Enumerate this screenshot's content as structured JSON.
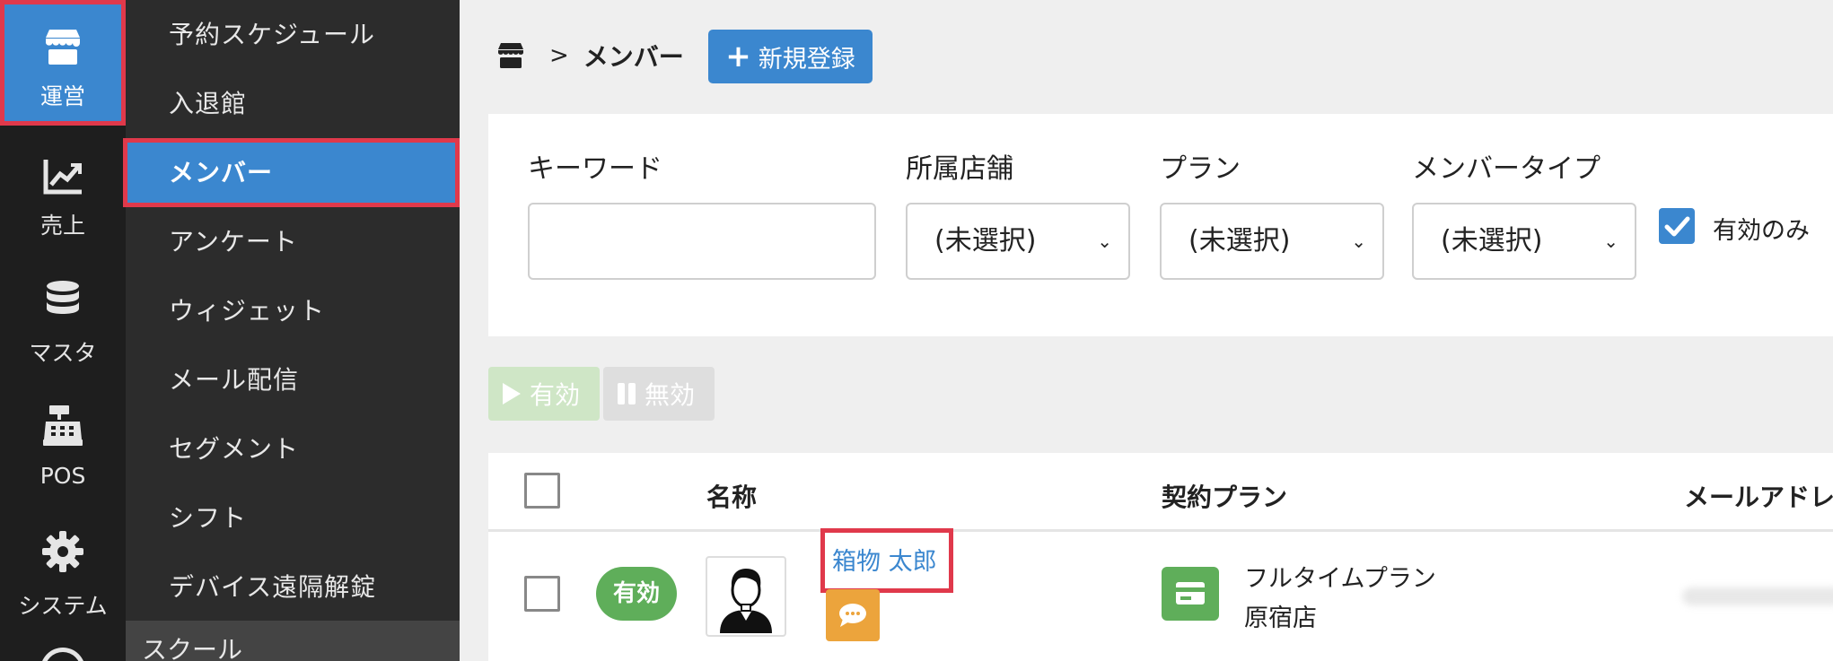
{
  "rail": {
    "items": [
      {
        "label": "運営",
        "icon": "store-icon",
        "active": true
      },
      {
        "label": "売上",
        "icon": "chart-line-icon"
      },
      {
        "label": "マスタ",
        "icon": "database-icon"
      },
      {
        "label": "POS",
        "icon": "cash-register-icon"
      },
      {
        "label": "システム",
        "icon": "gear-icon"
      }
    ]
  },
  "submenu": {
    "items": [
      {
        "label": "予約スケジュール"
      },
      {
        "label": "入退館"
      },
      {
        "label": "メンバー",
        "active": true
      },
      {
        "label": "アンケート"
      },
      {
        "label": "ウィジェット"
      },
      {
        "label": "メール配信"
      },
      {
        "label": "セグメント"
      },
      {
        "label": "シフト"
      },
      {
        "label": "デバイス遠隔解錠"
      }
    ],
    "section": "スクール"
  },
  "breadcrumb": {
    "home_icon": "store-icon",
    "separator": ">",
    "title": "メンバー"
  },
  "new_button": {
    "label": "新規登録"
  },
  "filters": {
    "keyword": {
      "label": "キーワード",
      "value": ""
    },
    "store": {
      "label": "所属店舗",
      "value": "(未選択)"
    },
    "plan": {
      "label": "プラン",
      "value": "(未選択)"
    },
    "member_type": {
      "label": "メンバータイプ",
      "value": "(未選択)"
    },
    "active_only": {
      "label": "有効のみ",
      "checked": true
    }
  },
  "actions": {
    "enable": "有効",
    "disable": "無効"
  },
  "table": {
    "headers": {
      "name": "名称",
      "plan": "契約プラン",
      "email": "メールアドレス"
    },
    "rows": [
      {
        "status": "有効",
        "name": "箱物 太郎",
        "plan": "フルタイムプラン",
        "store": "原宿店"
      }
    ]
  },
  "colors": {
    "accent": "#3b87cf",
    "success": "#5fae5a",
    "highlight": "#e0394b",
    "chat": "#eca43c"
  }
}
